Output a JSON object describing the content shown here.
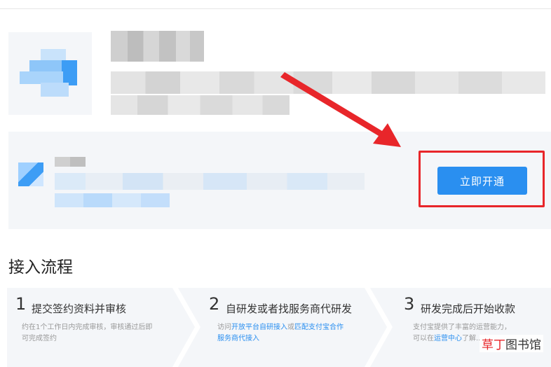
{
  "service_card": {
    "open_button_label": "立即开通"
  },
  "process": {
    "section_title": "接入流程",
    "steps": [
      {
        "number": "1",
        "title": "提交签约资料并审核",
        "desc_line1": "约在1个工作日内完成审核，审核通过后即",
        "desc_line2": "可完成签约"
      },
      {
        "number": "2",
        "title": "自研发或者找服务商代研发",
        "desc_prefix": "访问",
        "desc_link1": "开放平台自研接入",
        "desc_mid": "或",
        "desc_link2": "匹配支付宝合作",
        "desc_link3": "服务商代接入"
      },
      {
        "number": "3",
        "title": "研发完成后开始收款",
        "desc_line1": "支付宝提供了丰富的运营能力，",
        "desc_prefix2": "可以在",
        "desc_link": "运营中心",
        "desc_suffix": "了解..."
      }
    ]
  },
  "watermark": {
    "accent": "草丁",
    "rest": "图书馆"
  },
  "colors": {
    "primary_blue": "#2a8ff0",
    "highlight_red": "#e8262a",
    "card_bg": "#f4f6f9"
  }
}
